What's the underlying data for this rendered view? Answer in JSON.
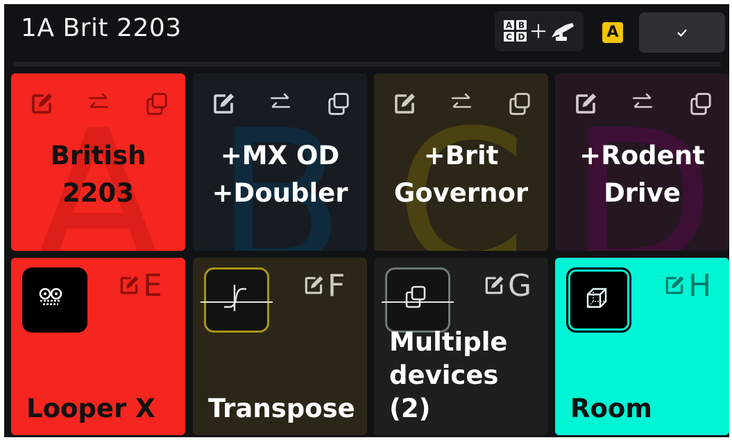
{
  "header": {
    "preset_name": "1A Brit 2203",
    "assign_icons": [
      "abcd-grid-icon",
      "plus-icon",
      "footswitch-icon"
    ],
    "badge": "A",
    "confirm_icon": "checkmark-icon",
    "confirm_label": "✓"
  },
  "tiles": [
    {
      "letter": "A",
      "name": "British\n2203",
      "bg": "#f4261f",
      "letter_color": "#dc1f18",
      "icon_color": "#8e0f0b",
      "name_color": "#111111"
    },
    {
      "letter": "B",
      "name": "+MX OD\n+Doubler",
      "bg": "#161c22",
      "letter_color": "#0f2a3c",
      "icon_color": "#d0d4da",
      "name_color": "#ffffff"
    },
    {
      "letter": "C",
      "name": "+Brit\nGovernor",
      "bg": "#2b2617",
      "letter_color": "#4a4211",
      "icon_color": "#cfcbbe",
      "name_color": "#ffffff"
    },
    {
      "letter": "D",
      "name": "+Rodent\nDrive",
      "bg": "#241721",
      "letter_color": "#3e0f34",
      "icon_color": "#d4cbd2",
      "name_color": "#ffffff"
    }
  ],
  "slots": [
    {
      "letter": "E",
      "label": "Looper X",
      "icon": "cassette-icon",
      "bypassed": false,
      "bg": "#f4261f",
      "fg": "#8b0f0b",
      "label_color": "#111111",
      "btn_bg": "#000000",
      "btn_border": "#000000"
    },
    {
      "letter": "F",
      "label": "Transpose",
      "icon": "s-curve-icon",
      "bypassed": true,
      "bg": "#2b2617",
      "fg": "#cfcbbe",
      "label_color": "#ffffff",
      "btn_bg": "#121210",
      "btn_border": "#a89416"
    },
    {
      "letter": "G",
      "label": "Multiple\ndevices (2)",
      "icon": "copy-icon",
      "bypassed": true,
      "bg": "#1d1f1e",
      "fg": "#cfd0cf",
      "label_color": "#ffffff",
      "btn_bg": "#121312",
      "btn_border": "#6e7a74"
    },
    {
      "letter": "H",
      "label": "Room",
      "icon": "cube-icon",
      "bypassed": false,
      "bg": "#00f5d4",
      "fg": "#0a7a6a",
      "label_color": "#111111",
      "btn_bg": "#000000",
      "btn_border": "#000000"
    }
  ]
}
